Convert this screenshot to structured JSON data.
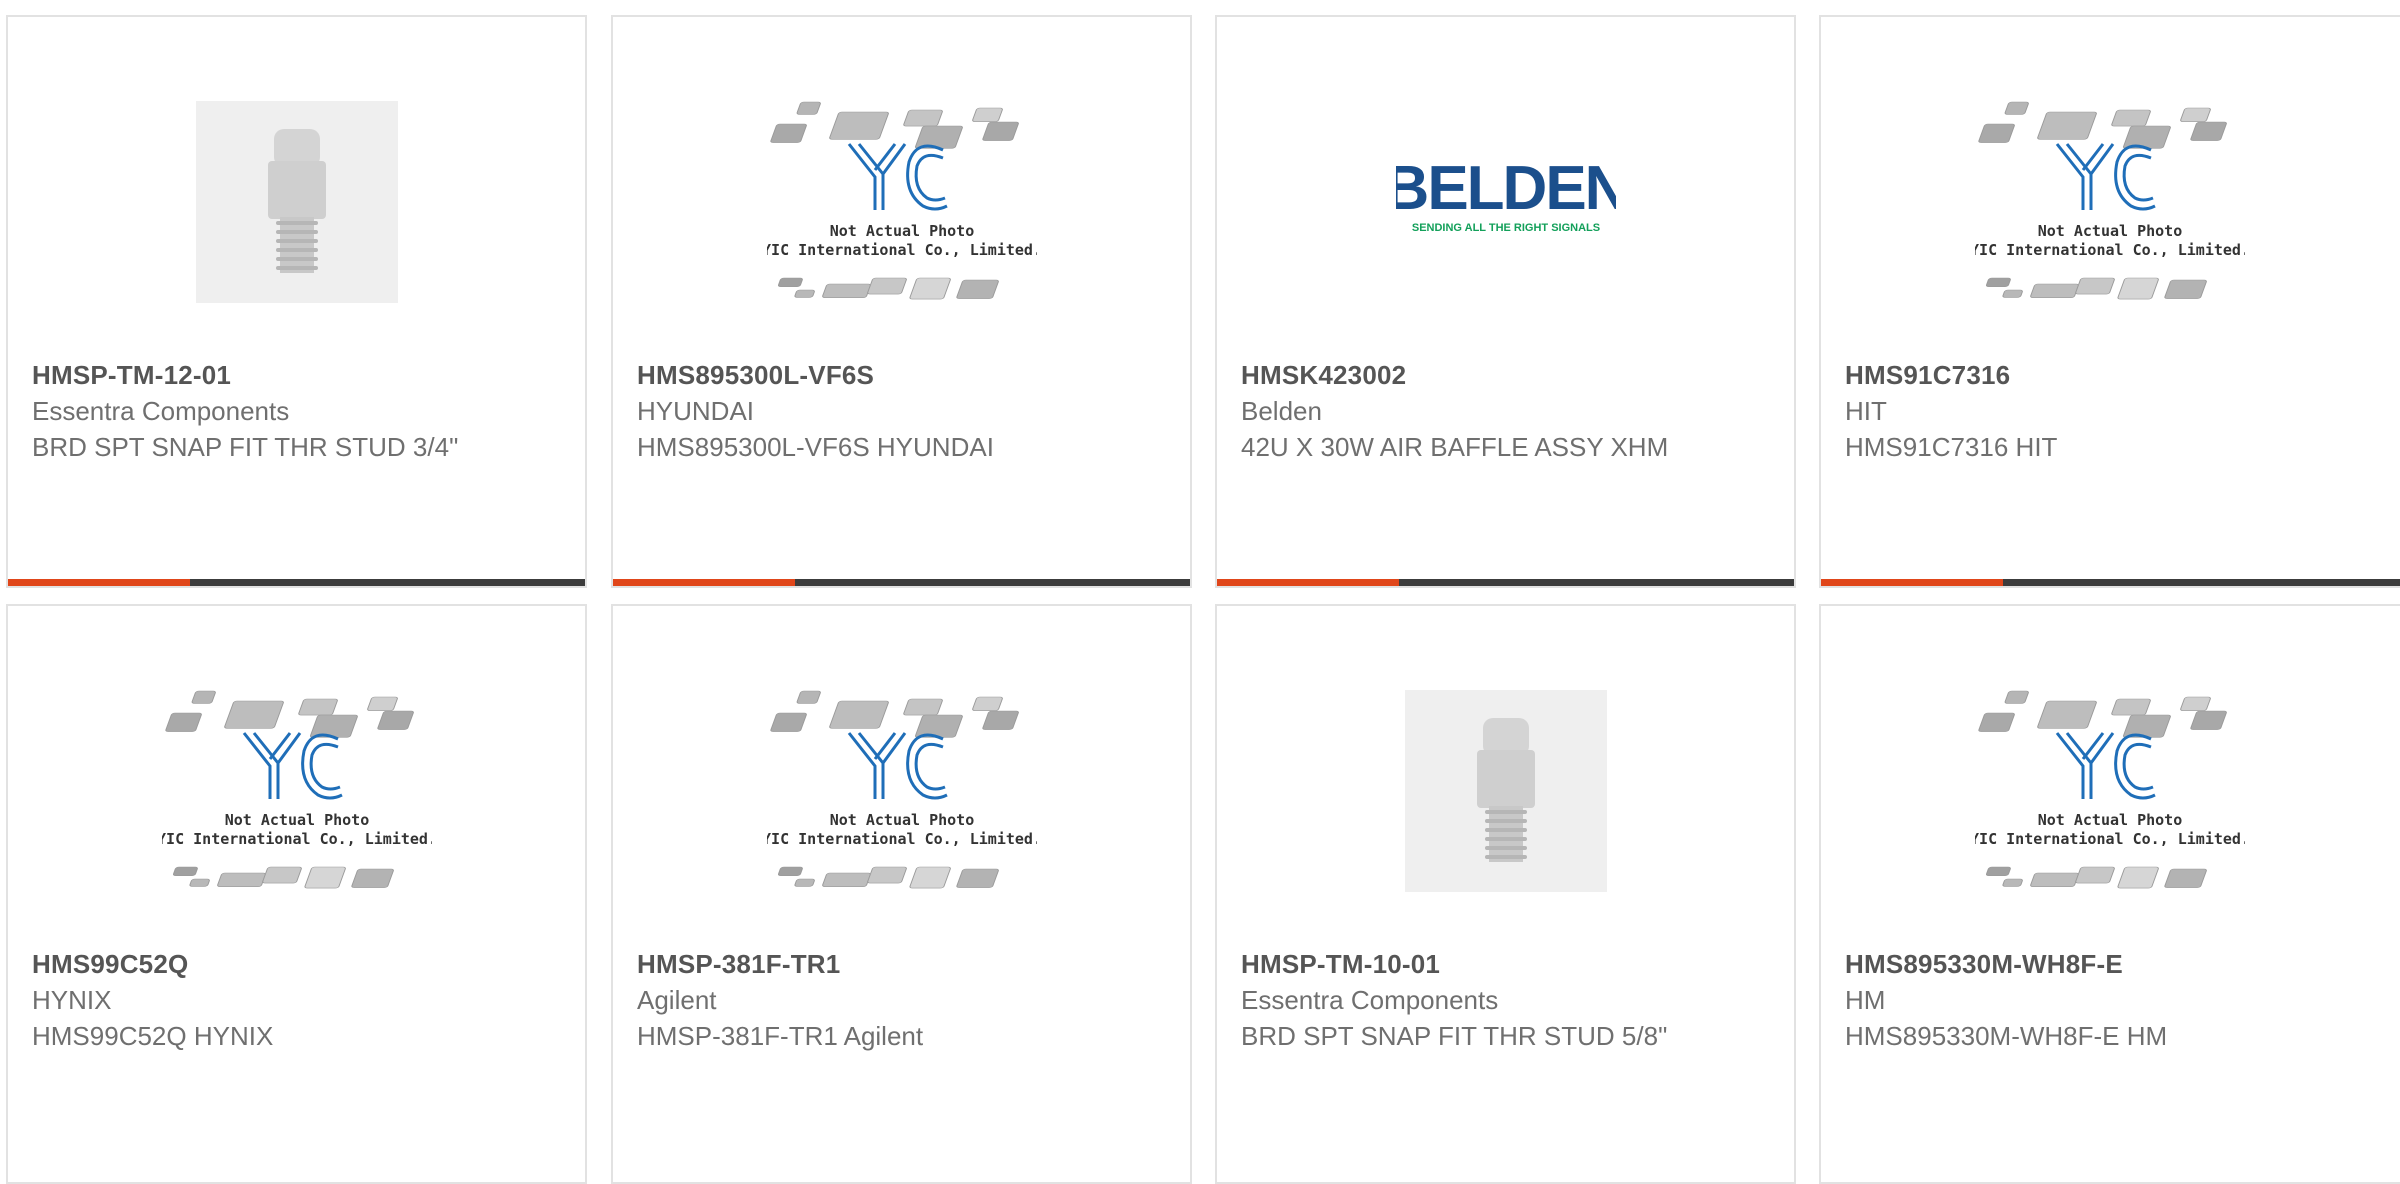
{
  "colors": {
    "accent": "#e0461a",
    "bar_dark": "#3c3c3c",
    "card_border": "#e2e2e2",
    "yic_blue": "#1f6eb8",
    "belden_blue": "#1b4f8c",
    "belden_green": "#13a05a"
  },
  "products": [
    {
      "part_number": "HMSP-TM-12-01",
      "manufacturer": "Essentra Components",
      "description": "BRD SPT SNAP FIT THR STUD 3/4\"",
      "image": "stud-photo"
    },
    {
      "part_number": "HMS895300L-VF6S",
      "manufacturer": "HYUNDAI",
      "description": "HMS895300L-VF6S HYUNDAI",
      "image": "yic-placeholder"
    },
    {
      "part_number": "HMSK423002",
      "manufacturer": "Belden",
      "description": "42U X 30W AIR BAFFLE ASSY XHM",
      "image": "belden-logo"
    },
    {
      "part_number": "HMS91C7316",
      "manufacturer": "HIT",
      "description": "HMS91C7316 HIT",
      "image": "yic-placeholder"
    },
    {
      "part_number": "HMS99C52Q",
      "manufacturer": "HYNIX",
      "description": "HMS99C52Q HYNIX",
      "image": "yic-placeholder"
    },
    {
      "part_number": "HMSP-381F-TR1",
      "manufacturer": "Agilent",
      "description": "HMSP-381F-TR1 Agilent",
      "image": "yic-placeholder"
    },
    {
      "part_number": "HMSP-TM-10-01",
      "manufacturer": "Essentra Components",
      "description": "BRD SPT SNAP FIT THR STUD 5/8\"",
      "image": "stud-photo"
    },
    {
      "part_number": "HMS895330M-WH8F-E",
      "manufacturer": "HM",
      "description": "HMS895330M-WH8F-E HM",
      "image": "yic-placeholder"
    }
  ],
  "placeholder": {
    "line1": "Not Actual Photo",
    "line2": "YIC International Co., Limited.",
    "logo": "YIC"
  },
  "belden": {
    "name": "BELDEN",
    "tagline": "SENDING ALL THE RIGHT SIGNALS"
  }
}
